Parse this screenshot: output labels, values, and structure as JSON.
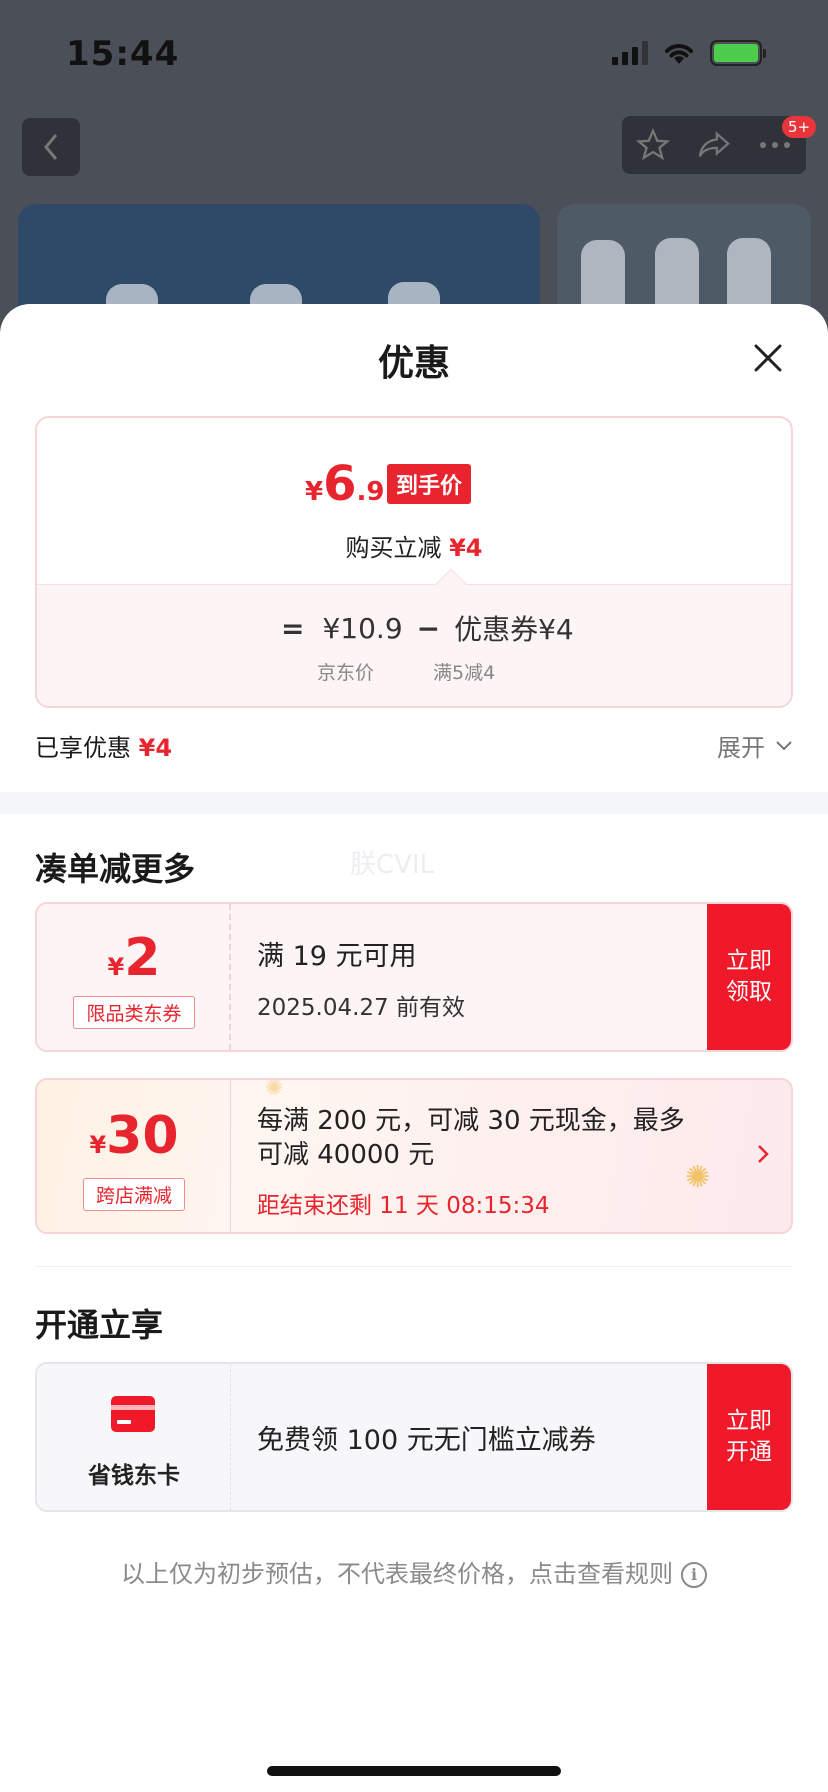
{
  "status_bar": {
    "time": "15:44"
  },
  "background": {
    "notification_badge": "5+"
  },
  "sheet": {
    "title": "优惠",
    "price_summary": {
      "currency": "¥",
      "final_int": "6",
      "final_dec": ".9",
      "final_tag": "到手价",
      "instant_label": "购买立减",
      "instant_value": "¥4",
      "calc_eq": "=",
      "base_price": "¥10.9",
      "minus": "−",
      "coupon_part": "优惠券¥4",
      "base_label": "京东价",
      "coupon_label": "满5减4"
    },
    "enjoyed": {
      "label": "已享优惠",
      "value": "¥4",
      "expand_label": "展开"
    },
    "more_section": {
      "title": "凑单减更多",
      "watermark": "朕CVIL",
      "coupons": [
        {
          "currency": "¥",
          "amount": "2",
          "tag": "限品类东券",
          "line1": "满 19 元可用",
          "line2": "2025.04.27 前有效",
          "cta": "立即领取"
        },
        {
          "currency": "¥",
          "amount": "30",
          "tag": "跨店满减",
          "line1": "每满 200 元，可减 30 元现金，最多",
          "line2": "可减 40000 元",
          "countdown": "距结束还剩 11 天 08:15:34"
        }
      ]
    },
    "open_section": {
      "title": "开通立享",
      "card_name": "省钱东卡",
      "desc": "免费领 100 元无门槛立减券",
      "cta": "立即开通"
    },
    "footer_note": "以上仅为初步预估，不代表最终价格，点击查看规则",
    "colors": {
      "accent": "#e8252e",
      "cta_red": "#f0192a"
    }
  }
}
